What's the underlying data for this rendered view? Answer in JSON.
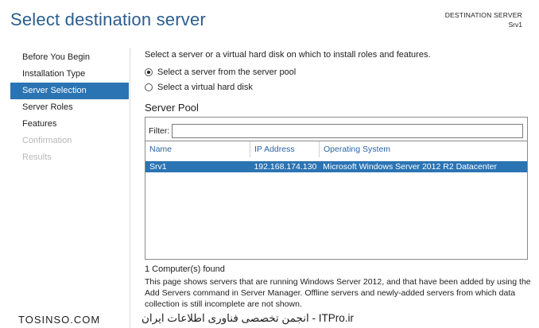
{
  "header": {
    "title": "Select destination server",
    "destination_label": "DESTINATION SERVER",
    "destination_value": "Srv1"
  },
  "nav": {
    "items": [
      {
        "label": "Before You Begin",
        "state": "normal"
      },
      {
        "label": "Installation Type",
        "state": "normal"
      },
      {
        "label": "Server Selection",
        "state": "active"
      },
      {
        "label": "Server Roles",
        "state": "normal"
      },
      {
        "label": "Features",
        "state": "normal"
      },
      {
        "label": "Confirmation",
        "state": "disabled"
      },
      {
        "label": "Results",
        "state": "disabled"
      }
    ]
  },
  "content": {
    "intro": "Select a server or a virtual hard disk on which to install roles and features.",
    "options": [
      {
        "label": "Select a server from the server pool",
        "checked": true
      },
      {
        "label": "Select a virtual hard disk",
        "checked": false
      }
    ],
    "pool_title": "Server Pool",
    "filter_label": "Filter:",
    "filter_value": "",
    "columns": [
      "Name",
      "IP Address",
      "Operating System"
    ],
    "rows": [
      {
        "name": "Srv1",
        "ip": "192.168.174.130",
        "os": "Microsoft Windows Server 2012 R2 Datacenter",
        "selected": true
      }
    ],
    "found": "1 Computer(s) found",
    "note": "This page shows servers that are running Windows Server 2012, and that have been added by using the Add Servers command in Server Manager. Offline servers and newly-added servers from which data collection is still incomplete are not shown."
  },
  "watermark": {
    "left": "TOSINSO.COM",
    "right": "ITPro.ir - انجمن تخصصی فناوری اطلاعات ایران"
  },
  "colors": {
    "title": "#2a5d8c",
    "accent": "#2b74b4",
    "column_header": "#2b63a5"
  }
}
